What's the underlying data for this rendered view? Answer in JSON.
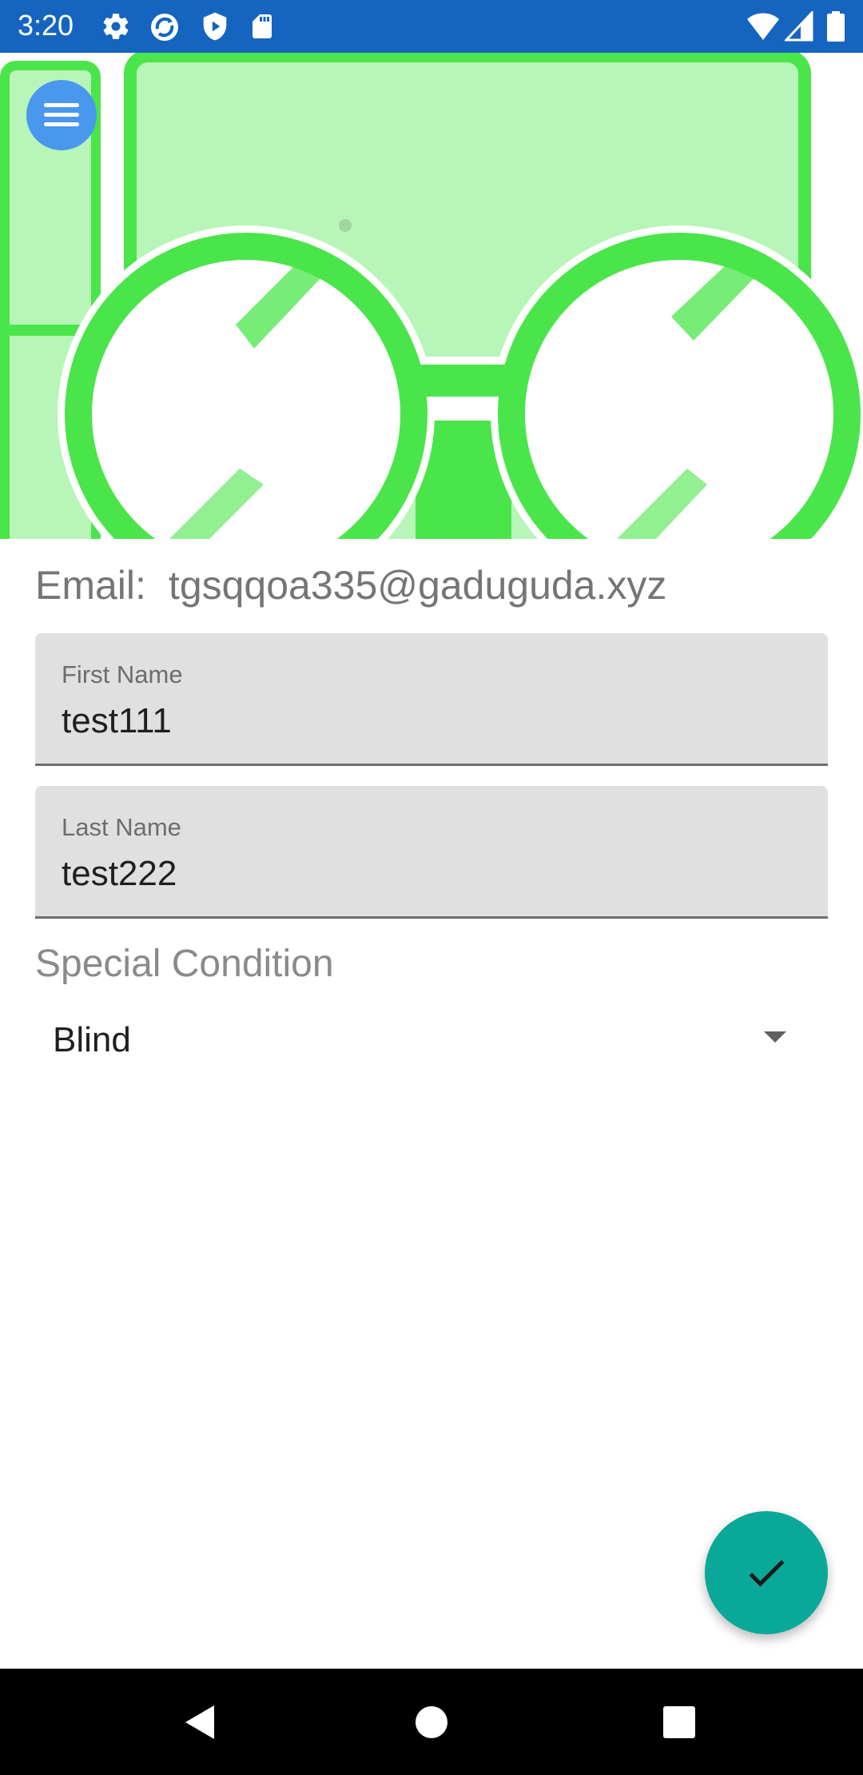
{
  "status_bar": {
    "time": "3:20",
    "left_icons": [
      "gear-icon",
      "sync-icon",
      "play-shield-icon",
      "sd-card-icon"
    ],
    "right_icons": [
      "wifi-icon",
      "cell-signal-icon",
      "battery-icon"
    ],
    "background": "#1565c0"
  },
  "header": {
    "image": "glasses-logo",
    "menu_icon": "hamburger-menu-icon",
    "colors": {
      "green": "#4ae54a",
      "light_green": "#b8f5b8",
      "menu_blue": "#4a97ee"
    }
  },
  "profile": {
    "email_label": "Email:",
    "email_value": "tgsqqoa335@gaduguda.xyz",
    "first_name": {
      "label": "First Name",
      "value": "test111"
    },
    "last_name": {
      "label": "Last Name",
      "value": "test222"
    },
    "special_condition": {
      "title": "Special Condition",
      "selected": "Blind"
    }
  },
  "fab": {
    "icon": "checkmark-icon",
    "color": "#0aa898"
  },
  "nav_bar": {
    "buttons": [
      "back-icon",
      "home-icon",
      "recents-icon"
    ]
  }
}
